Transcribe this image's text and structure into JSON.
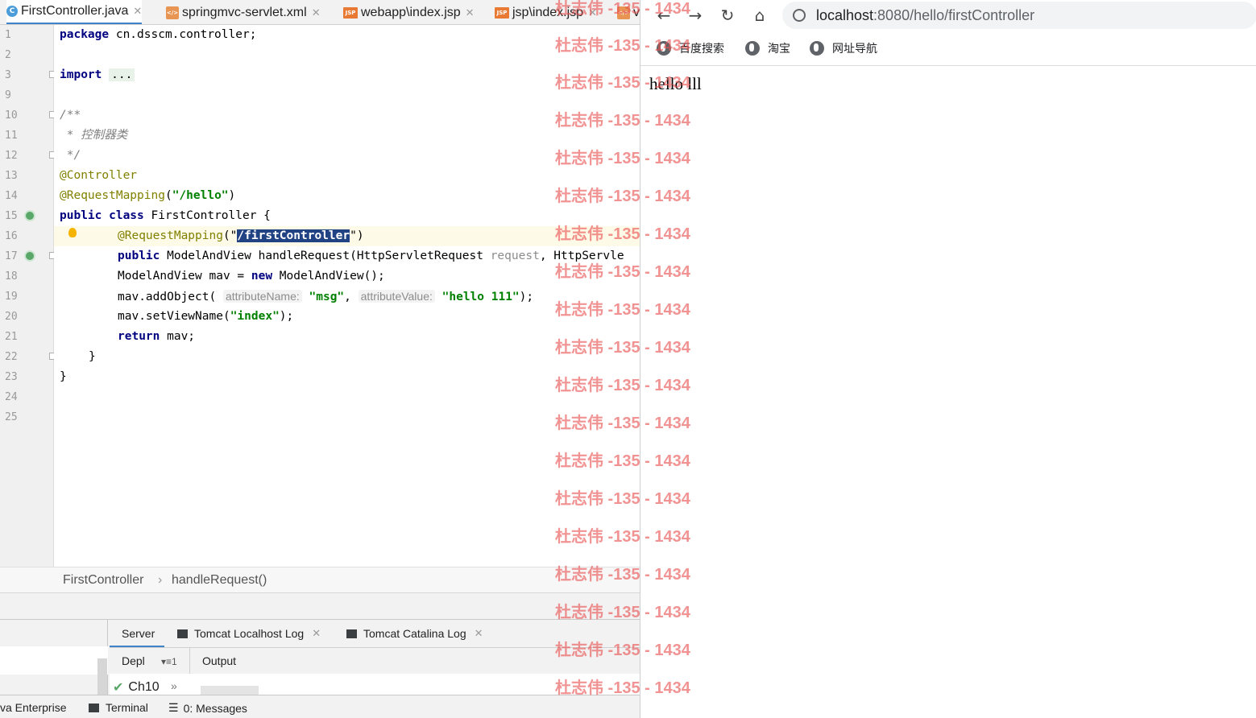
{
  "ide": {
    "tabs": [
      {
        "label": "FirstController.java",
        "icon": "java-class-icon",
        "active": true
      },
      {
        "label": "springmvc-servlet.xml",
        "icon": "xml-file-icon"
      },
      {
        "label": "webapp\\index.jsp",
        "icon": "jsp-file-icon"
      },
      {
        "label": "jsp\\index.jsp",
        "icon": "jsp-file-icon"
      },
      {
        "label": "v",
        "icon": "xml-file-icon"
      }
    ],
    "line_numbers": [
      "1",
      "2",
      "3",
      "9",
      "10",
      "11",
      "12",
      "13",
      "14",
      "15",
      "16",
      "17",
      "18",
      "19",
      "20",
      "21",
      "22",
      "23",
      "24",
      "25"
    ],
    "code": {
      "l1_kw": "package",
      "l1_rest": " cn.dsscm.controller;",
      "l3_kw": "import",
      "l3_rest": "...",
      "l10": "/**",
      "l11": " * 控制器类",
      "l12": " */",
      "l13": "@Controller",
      "l14_an": "@RequestMapping",
      "l14_p1": "(",
      "l14_str": "\"/hello\"",
      "l14_p2": ")",
      "l15_kw": "public class",
      "l15_rest": " FirstController {",
      "l16_an": "@RequestMapping",
      "l16_p1": "(\"",
      "l16_sel": "/firstController",
      "l16_p2": "\")",
      "l17_kw": "public",
      "l17_rest": " ModelAndView handleRequest(HttpServletRequest ",
      "l17_hint": "request",
      "l17_rest2": ", HttpServle",
      "l18_a": "ModelAndView mav = ",
      "l18_kw": "new",
      "l18_b": " ModelAndView();",
      "l19_a": "mav.addObject( ",
      "l19_h1": "attributeName:",
      "l19_s1": "\"msg\"",
      "l19_c": ", ",
      "l19_h2": "attributeValue:",
      "l19_s2": "\"hello 111\"",
      "l19_d": ");",
      "l20_a": "mav.setViewName(",
      "l20_s": "\"index\"",
      "l20_b": ");",
      "l21_kw": "return",
      "l21_rest": " mav;",
      "l22": "}",
      "l23": "}"
    },
    "breadcrumbs": [
      "FirstController",
      "handleRequest()"
    ],
    "services": {
      "tabs": [
        "Server",
        "Tomcat Localhost Log",
        "Tomcat Catalina Log"
      ],
      "deploy_label": "Depl",
      "output_label": "Output",
      "artifact": "Ch10"
    },
    "statusbar": [
      "va Enterprise",
      "Terminal",
      "0: Messages"
    ]
  },
  "watermark": "杜志伟 -135 - 1434",
  "browser": {
    "url_host": "localhost",
    "url_rest": ":8080/hello/firstController",
    "bookmarks": [
      "百度搜索",
      "淘宝",
      "网址导航"
    ],
    "page_text": "hello lll"
  }
}
